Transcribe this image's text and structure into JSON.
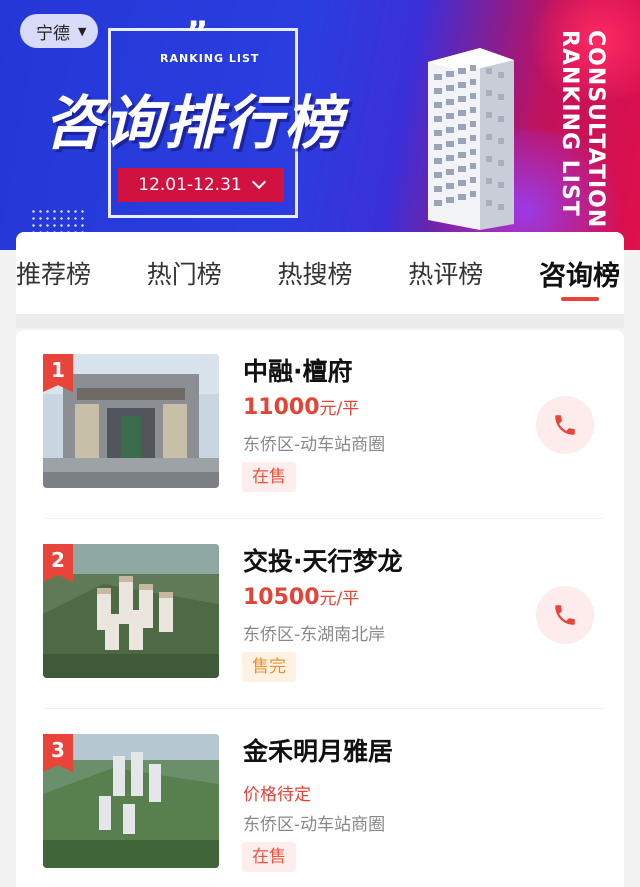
{
  "banner": {
    "location": "宁德",
    "ranking_small": "RANKING LIST",
    "title": "咨询排行榜",
    "date_range": "12.01-12.31",
    "side_text_1": "CONSULTATION",
    "side_text_2": "RANKING LIST"
  },
  "tabs": [
    {
      "label": "推荐榜",
      "active": false
    },
    {
      "label": "热门榜",
      "active": false
    },
    {
      "label": "热搜榜",
      "active": false
    },
    {
      "label": "热评榜",
      "active": false
    },
    {
      "label": "咨询榜",
      "active": true
    }
  ],
  "colors": {
    "accent": "#e8443a",
    "price": "#e34438",
    "onsale_bg": "#fdeeed",
    "soldout": "#ee8f2e"
  },
  "listings": [
    {
      "rank": "1",
      "name": "中融·檀府",
      "price_value": "11000",
      "price_unit": "元/平",
      "area": "东侨区-动车站商圈",
      "status": "在售",
      "status_type": "onsale",
      "icon": "phone-icon"
    },
    {
      "rank": "2",
      "name": "交投·天行梦龙",
      "price_value": "10500",
      "price_unit": "元/平",
      "area": "东侨区-东湖南北岸",
      "status": "售完",
      "status_type": "soldout",
      "icon": "phone-icon"
    },
    {
      "rank": "3",
      "name": "金禾明月雅居",
      "price_text": "价格待定",
      "area": "东侨区-动车站商圈",
      "status": "在售",
      "status_type": "onsale"
    }
  ]
}
